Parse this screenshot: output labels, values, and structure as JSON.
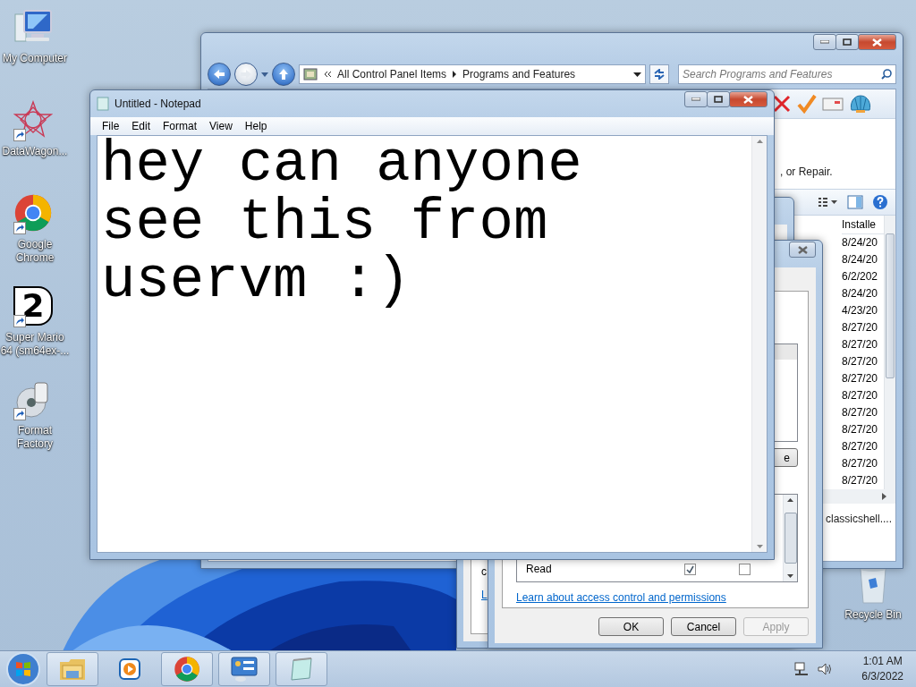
{
  "desktop_icons": [
    {
      "kind": "computer",
      "label": "My Computer",
      "shortcut": false
    },
    {
      "kind": "star",
      "label": "DataWagon...",
      "shortcut": true
    },
    {
      "kind": "chrome",
      "label": "Google Chrome",
      "shortcut": true
    },
    {
      "kind": "number",
      "label": "Super Mario 64 (sm64ex-...",
      "glyph": "2",
      "shortcut": true
    },
    {
      "kind": "disc",
      "label": "Format Factory",
      "shortcut": true
    }
  ],
  "recycle_bin": {
    "label": "Recycle Bin"
  },
  "programs_window": {
    "breadcrumb": [
      "All Control Panel Items",
      "Programs and Features"
    ],
    "search": {
      "placeholder": "Search Programs and Features"
    },
    "description": ", or Repair.",
    "column_header": "Installe",
    "dates": [
      "8/24/20",
      "8/24/20",
      "6/2/202",
      "8/24/20",
      "4/23/20",
      "8/27/20",
      "8/27/20",
      "8/27/20",
      "8/27/20",
      "8/27/20",
      "8/27/20",
      "8/27/20",
      "8/27/20",
      "8/27/20",
      "8/27/20"
    ],
    "footer": "classicshell...."
  },
  "properties_dialog": {
    "text": "c",
    "link": "L"
  },
  "permissions_dialog": {
    "partial_button": "e",
    "rows": [
      {
        "name": "Read",
        "allow": true,
        "deny": false
      }
    ],
    "link": "Learn about access control and permissions",
    "buttons": [
      {
        "label": "OK",
        "disabled": false
      },
      {
        "label": "Cancel",
        "disabled": false
      },
      {
        "label": "Apply",
        "disabled": true
      }
    ]
  },
  "notepad": {
    "title": "Untitled - Notepad",
    "menu": [
      "File",
      "Edit",
      "Format",
      "View",
      "Help"
    ],
    "text": "hey can anyone\nsee this from\nuservm :)"
  },
  "taskbar": {
    "items": [
      {
        "kind": "explorer",
        "running": true
      },
      {
        "kind": "media",
        "running": false
      },
      {
        "kind": "chrome",
        "running": true
      },
      {
        "kind": "control-panel",
        "running": true
      },
      {
        "kind": "notepad",
        "running": true
      }
    ],
    "clock": {
      "time": "1:01 AM",
      "date": "6/3/2022"
    }
  }
}
